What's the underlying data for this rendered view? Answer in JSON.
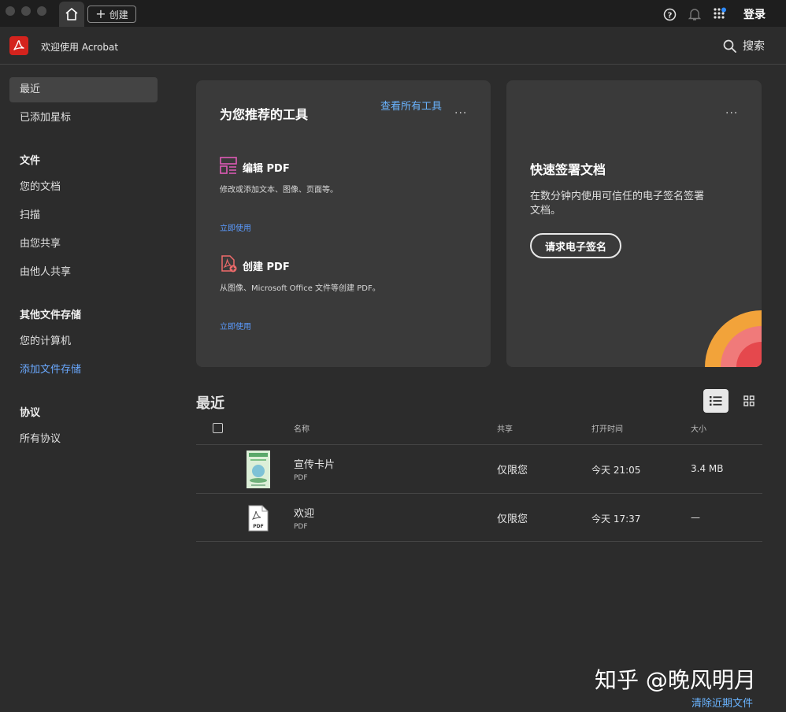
{
  "titlebar": {
    "create_label": "创建",
    "login_label": "登录"
  },
  "header": {
    "title": "欢迎使用 Acrobat",
    "search_label": "搜索"
  },
  "sidebar": {
    "recent": "最近",
    "starred": "已添加星标",
    "files_heading": "文件",
    "your_docs": "您的文档",
    "scan": "扫描",
    "shared_by_you": "由您共享",
    "shared_by_others": "由他人共享",
    "other_storage_heading": "其他文件存储",
    "your_computer": "您的计算机",
    "add_storage": "添加文件存储",
    "agreements_heading": "协议",
    "all_agreements": "所有协议"
  },
  "tools_card": {
    "title": "为您推荐的工具",
    "see_all": "查看所有工具",
    "more": "···",
    "tools": [
      {
        "name": "编辑 PDF",
        "desc": "修改或添加文本、图像、页面等。",
        "link": "立即使用"
      },
      {
        "name": "创建 PDF",
        "desc": "从图像、Microsoft Office 文件等创建 PDF。",
        "link": "立即使用"
      }
    ]
  },
  "sign_card": {
    "title": "快速签署文档",
    "desc": "在数分钟内使用可信任的电子签名签署文档。",
    "button": "请求电子签名",
    "more": "···"
  },
  "recent": {
    "title": "最近",
    "columns": {
      "name": "名称",
      "share": "共享",
      "opened": "打开时间",
      "size": "大小"
    },
    "rows": [
      {
        "name": "宣传卡片",
        "type": "PDF",
        "share": "仅限您",
        "opened": "今天 21:05",
        "size": "3.4 MB"
      },
      {
        "name": "欢迎",
        "type": "PDF",
        "share": "仅限您",
        "opened": "今天 17:37",
        "size": "—"
      }
    ]
  },
  "footer": {
    "watermark": "知乎 @晚风明月",
    "clear_recent": "清除近期文件"
  },
  "colors": {
    "accent": "#6ab4ff",
    "brand": "#d4231d",
    "background": "#2c2c2c",
    "card": "#3a3a3a"
  }
}
